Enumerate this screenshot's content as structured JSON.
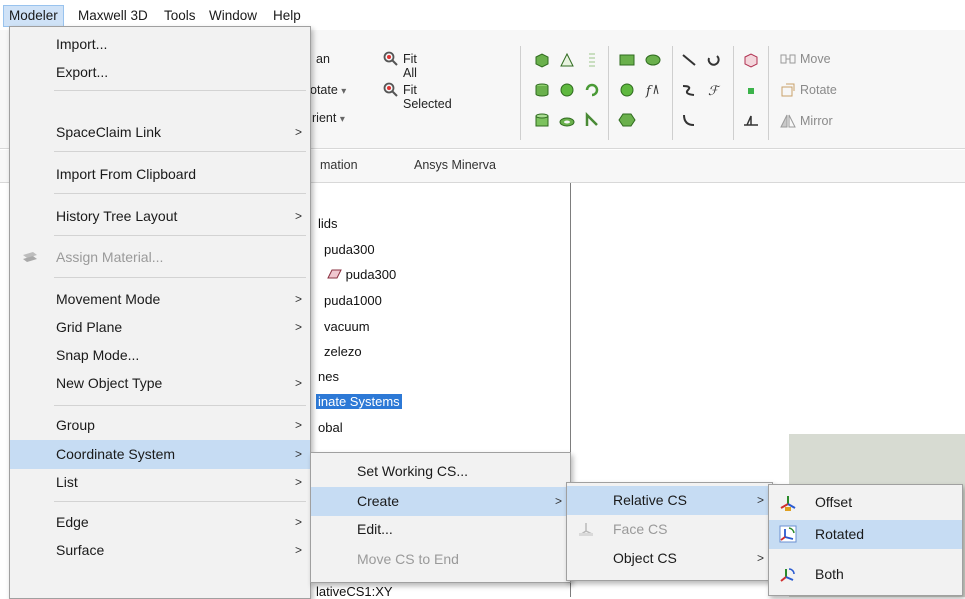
{
  "menubar": {
    "items": [
      "Modeler",
      "Maxwell 3D",
      "Tools",
      "Window",
      "Help"
    ]
  },
  "ribbon": {
    "fit_all": "Fit All",
    "fit_selected": "Fit Selected",
    "pan_partial": "an",
    "rotate_partial": "otate",
    "orient_partial": "rient",
    "move": "Move",
    "rotate": "Rotate",
    "mirror": "Mirror",
    "dropdown_glyph": "▾"
  },
  "tabs": [
    "mation",
    "Ansys Minerva"
  ],
  "tree": {
    "items": [
      "lids",
      "puda300",
      "puda300",
      "puda1000",
      "vacuum",
      "zelezo",
      "nes",
      "inate Systems",
      "obal",
      "lativeCS1:XY"
    ]
  },
  "modeler_menu": {
    "items": [
      {
        "label": "Import...",
        "submenu": false,
        "disabled": false
      },
      {
        "label": "Export...",
        "submenu": false,
        "disabled": false
      },
      {
        "label": "SpaceClaim Link",
        "submenu": true,
        "disabled": false
      },
      {
        "label": "Import From Clipboard",
        "submenu": false,
        "disabled": false
      },
      {
        "label": "History Tree Layout",
        "submenu": true,
        "disabled": false
      },
      {
        "label": "Assign Material...",
        "submenu": false,
        "disabled": true
      },
      {
        "label": "Movement Mode",
        "submenu": true,
        "disabled": false
      },
      {
        "label": "Grid Plane",
        "submenu": true,
        "disabled": false
      },
      {
        "label": "Snap Mode...",
        "submenu": false,
        "disabled": false
      },
      {
        "label": "New Object Type",
        "submenu": true,
        "disabled": false
      },
      {
        "label": "Group",
        "submenu": true,
        "disabled": false
      },
      {
        "label": "Coordinate System",
        "submenu": true,
        "disabled": false
      },
      {
        "label": "List",
        "submenu": true,
        "disabled": false
      },
      {
        "label": "Edge",
        "submenu": true,
        "disabled": false
      },
      {
        "label": "Surface",
        "submenu": true,
        "disabled": false
      }
    ],
    "arrow": ">"
  },
  "cs_menu": {
    "items": [
      {
        "label": "Set Working CS...",
        "submenu": false,
        "disabled": false
      },
      {
        "label": "Create",
        "submenu": true,
        "disabled": false
      },
      {
        "label": "Edit...",
        "submenu": false,
        "disabled": false
      },
      {
        "label": "Move CS to End",
        "submenu": false,
        "disabled": true
      }
    ]
  },
  "create_menu": {
    "items": [
      {
        "label": "Relative CS",
        "submenu": true,
        "disabled": false
      },
      {
        "label": "Face CS",
        "submenu": false,
        "disabled": true
      },
      {
        "label": "Object CS",
        "submenu": true,
        "disabled": false
      }
    ]
  },
  "relative_menu": {
    "items": [
      {
        "label": "Offset"
      },
      {
        "label": "Rotated"
      },
      {
        "label": "Both"
      }
    ]
  },
  "colors": {
    "highlight": "#c6dcf3",
    "tree_selection": "#2d79d6",
    "menu_bg": "#f2f2f2"
  }
}
